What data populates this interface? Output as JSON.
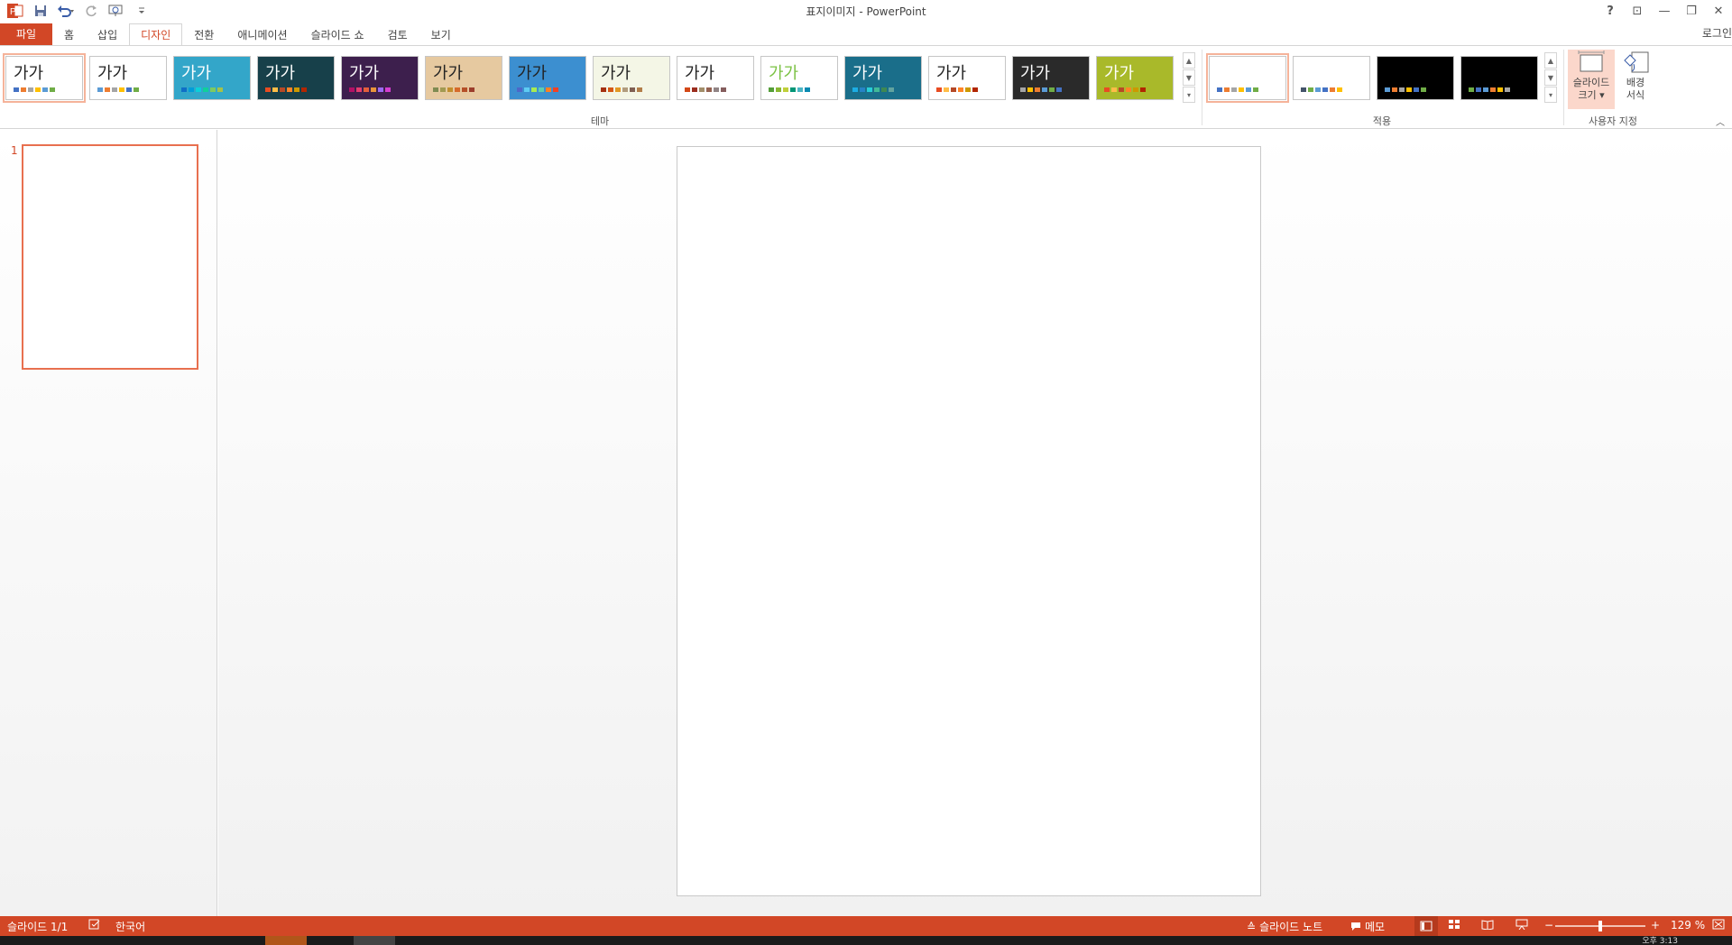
{
  "window": {
    "title": "표지이미지 - PowerPoint",
    "controls": {
      "help": "?",
      "ribbon_display": "⊡",
      "minimize": "—",
      "restore": "❐",
      "close": "✕"
    },
    "login": "로그인"
  },
  "qat": {
    "icons": [
      "powerpoint-logo",
      "save-icon",
      "undo-icon",
      "redo-icon",
      "start-from-beginning-icon",
      "customize-qat-icon"
    ]
  },
  "tabs": {
    "file": "파일",
    "items": [
      "홈",
      "삽입",
      "디자인",
      "전환",
      "애니메이션",
      "슬라이드 쇼",
      "검토",
      "보기"
    ],
    "active": "디자인"
  },
  "ribbon": {
    "groups": {
      "themes": "테마",
      "variants": "적용",
      "customize": "사용자 지정"
    },
    "theme_sample_text": "가가",
    "themes": [
      {
        "bg": "#ffffff",
        "fg": "#222222",
        "swatches": [
          "#4472c4",
          "#ed7d31",
          "#a5a5a5",
          "#ffc000",
          "#5b9bd5",
          "#70ad47"
        ]
      },
      {
        "bg": "#ffffff",
        "fg": "#222222",
        "swatches": [
          "#5b9bd5",
          "#ed7d31",
          "#a5a5a5",
          "#ffc000",
          "#4472c4",
          "#70ad47"
        ]
      },
      {
        "bg": "#33a6c9",
        "fg": "#ffffff",
        "swatches": [
          "#0f6fc6",
          "#009dd9",
          "#0bd0d9",
          "#10cf9b",
          "#7cca62",
          "#a5c249"
        ]
      },
      {
        "bg": "#17404a",
        "fg": "#ffffff",
        "swatches": [
          "#e84c22",
          "#ffbd47",
          "#b64926",
          "#ff8427",
          "#cc9900",
          "#b22600"
        ]
      },
      {
        "bg": "#3d1f4d",
        "fg": "#ffffff",
        "swatches": [
          "#b31166",
          "#e33d6f",
          "#e45f3c",
          "#e9943a",
          "#9b6bf2",
          "#d53dd0"
        ]
      },
      {
        "bg": "#e6c9a0",
        "fg": "#222222",
        "swatches": [
          "#7f8b52",
          "#a29a52",
          "#c28e2e",
          "#d66a2a",
          "#b54f27",
          "#9b3d2b"
        ]
      },
      {
        "bg": "#3c8fd0",
        "fg": "#222222",
        "swatches": [
          "#4e67c8",
          "#5eccf3",
          "#a7ea52",
          "#5dceaf",
          "#ff8021",
          "#f14124"
        ]
      },
      {
        "bg": "#f4f6e6",
        "fg": "#222222",
        "swatches": [
          "#a5300f",
          "#d55816",
          "#e19825",
          "#b19c7d",
          "#7f5f52",
          "#b27d49"
        ]
      },
      {
        "bg": "#ffffff",
        "fg": "#222222",
        "swatches": [
          "#d34817",
          "#9b2d1f",
          "#a28e6a",
          "#956251",
          "#918485",
          "#855d5d"
        ]
      },
      {
        "bg": "#ffffff",
        "fg": "#7ac142",
        "swatches": [
          "#549e39",
          "#8ab833",
          "#c0cf3a",
          "#029676",
          "#4ab5c4",
          "#0989b1"
        ]
      },
      {
        "bg": "#1a6e8a",
        "fg": "#ffffff",
        "swatches": [
          "#1cade4",
          "#2683c6",
          "#27ced7",
          "#42ba97",
          "#3e8853",
          "#62a39f"
        ]
      },
      {
        "bg": "#ffffff",
        "fg": "#222222",
        "swatches": [
          "#e84c22",
          "#ffbd47",
          "#b64926",
          "#ff8427",
          "#cc9900",
          "#b22600"
        ]
      },
      {
        "bg": "#2a2a2a",
        "fg": "#ffffff",
        "swatches": [
          "#a5a5a5",
          "#ffc000",
          "#ed7d31",
          "#5b9bd5",
          "#70ad47",
          "#4472c4"
        ]
      },
      {
        "bg": "#a9b92a",
        "fg": "#ffffff",
        "swatches": [
          "#e84c22",
          "#ffbd47",
          "#b64926",
          "#ff8427",
          "#cc9900",
          "#b22600"
        ]
      }
    ],
    "variants": [
      {
        "bg": "#ffffff",
        "swatches": [
          "#4472c4",
          "#ed7d31",
          "#a5a5a5",
          "#ffc000",
          "#5b9bd5",
          "#70ad47"
        ]
      },
      {
        "bg": "#ffffff",
        "swatches": [
          "#44546a",
          "#70ad47",
          "#5b9bd5",
          "#4472c4",
          "#ed7d31",
          "#ffc000"
        ]
      },
      {
        "bg": "#000000",
        "swatches": [
          "#5b9bd5",
          "#ed7d31",
          "#a5a5a5",
          "#ffc000",
          "#4472c4",
          "#70ad47"
        ]
      },
      {
        "bg": "#000000",
        "swatches": [
          "#70ad47",
          "#4472c4",
          "#5b9bd5",
          "#ed7d31",
          "#ffc000",
          "#a5a5a5"
        ]
      }
    ],
    "slide_size": {
      "line1": "슬라이드",
      "line2": "크기"
    },
    "format_background": {
      "line1": "배경",
      "line2": "서식"
    }
  },
  "slides_panel": {
    "number": "1"
  },
  "statusbar": {
    "slide_counter": "슬라이드 1/1",
    "language": "한국어",
    "notes": "슬라이드 노트",
    "comments": "메모",
    "zoom_minus": "−",
    "zoom_plus": "+",
    "zoom_fraction": 0.5,
    "zoom": "129 %"
  },
  "taskbar": {
    "clock": "오후 3:13"
  },
  "colors": {
    "accent": "#d24726",
    "thumb_border": "#e8704f"
  }
}
